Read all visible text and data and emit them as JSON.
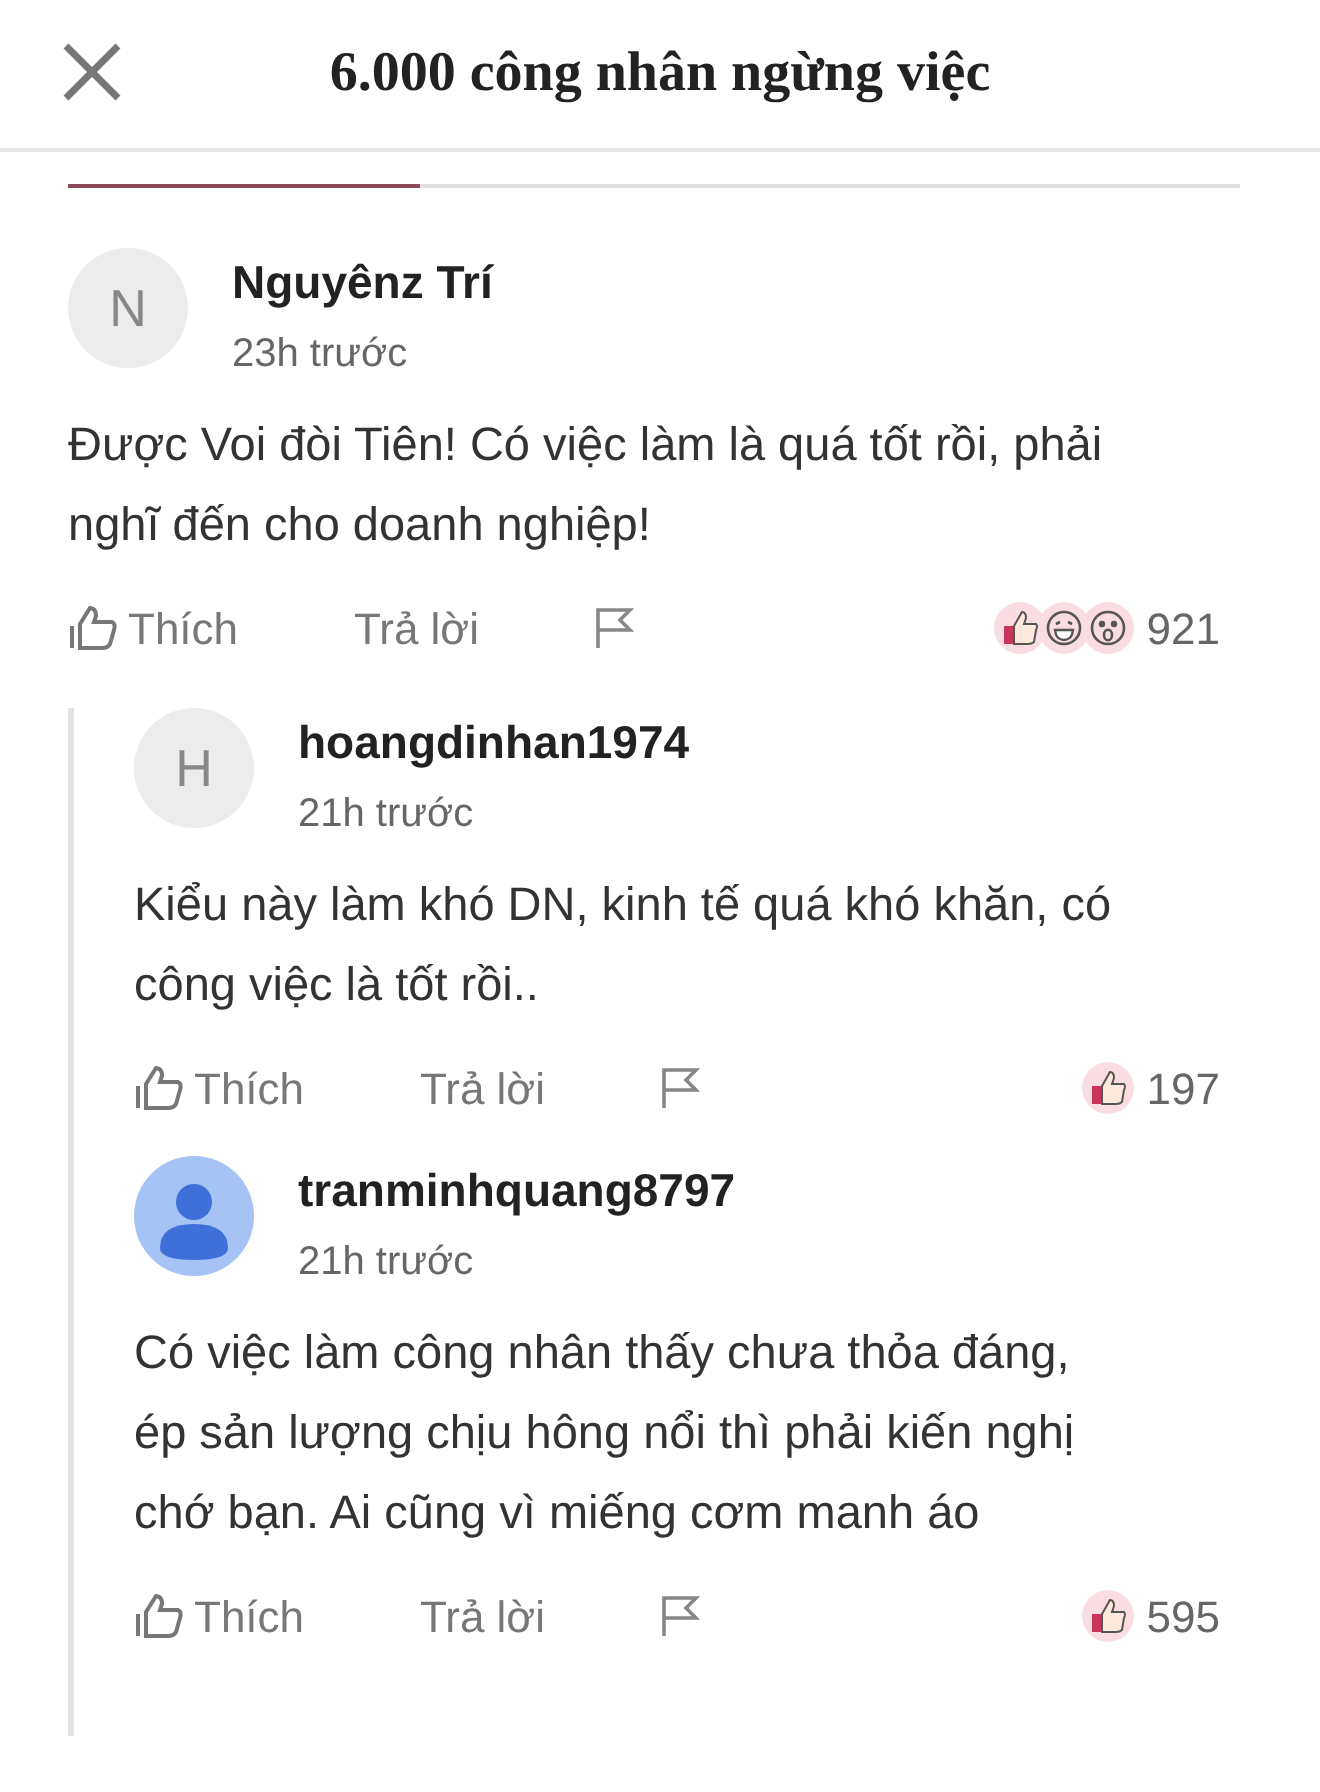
{
  "header": {
    "title": "6.000 công nhân ngừng việc"
  },
  "comments": [
    {
      "avatar": {
        "kind": "letter",
        "letter": "N"
      },
      "author": "Nguyênz Trí",
      "time": "23h trước",
      "text_lines": [
        "Được Voi đòi Tiên! Có việc làm là quá tốt rồi, phải",
        "nghĩ đến cho doanh nghiệp!"
      ],
      "like_label": "Thích",
      "reply_label": "Trả lời",
      "reactions": [
        {
          "kind": "like"
        },
        {
          "kind": "laugh"
        },
        {
          "kind": "wow"
        }
      ],
      "count": "921",
      "children": [
        {
          "avatar": {
            "kind": "letter",
            "letter": "H"
          },
          "author": "hoangdinhan1974",
          "time": "21h trước",
          "text_lines": [
            "Kiểu này làm khó DN, kinh tế quá khó khăn, có",
            "công việc là tốt rồi.."
          ],
          "like_label": "Thích",
          "reply_label": "Trả lời",
          "reactions": [
            {
              "kind": "like"
            }
          ],
          "count": "197"
        },
        {
          "avatar": {
            "kind": "person"
          },
          "author": "tranminhquang8797",
          "time": "21h trước",
          "text_lines": [
            "Có việc làm công nhân thấy chưa thỏa đáng,",
            "ép sản lượng chịu hông nổi thì phải kiến nghị",
            "chớ bạn. Ai cũng vì miếng cơm manh áo"
          ],
          "like_label": "Thích",
          "reply_label": "Trả lời",
          "reactions": [
            {
              "kind": "like"
            }
          ],
          "count": "595"
        }
      ]
    }
  ]
}
